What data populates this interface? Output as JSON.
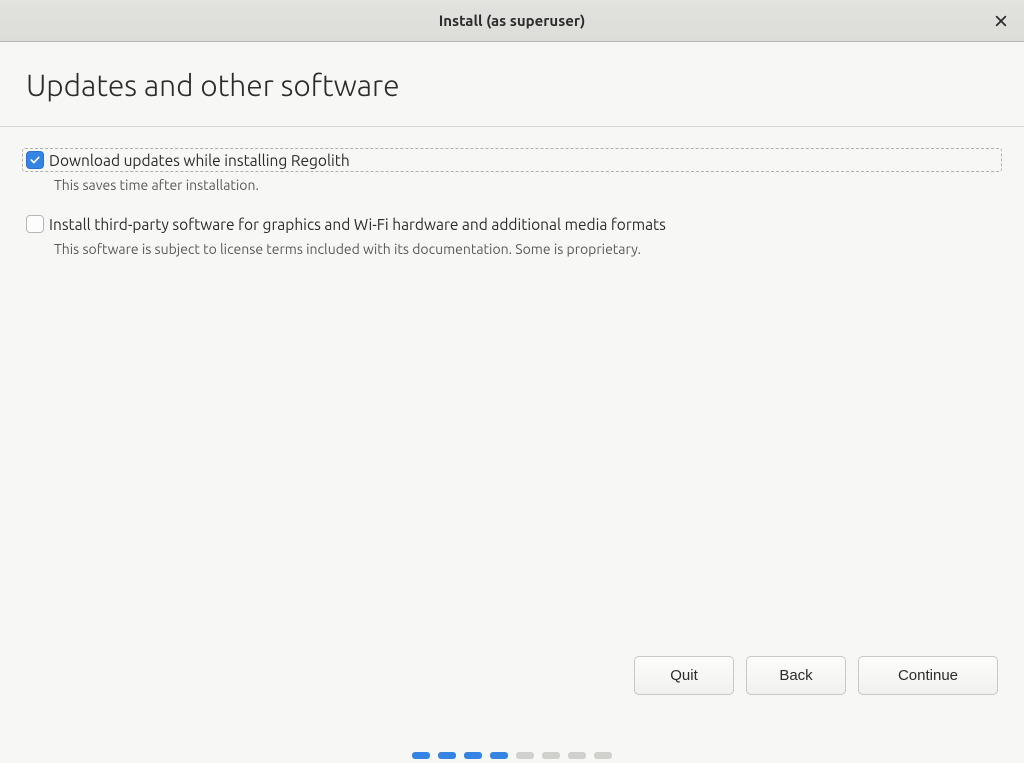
{
  "titlebar": {
    "title": "Install (as superuser)"
  },
  "page": {
    "heading": "Updates and other software"
  },
  "options": {
    "download_updates": {
      "label": "Download updates while installing Regolith",
      "description": "This saves time after installation.",
      "checked": true
    },
    "third_party": {
      "label": "Install third-party software for graphics and Wi-Fi hardware and additional media formats",
      "description": "This software is subject to license terms included with its documentation. Some is proprietary.",
      "checked": false
    }
  },
  "buttons": {
    "quit": "Quit",
    "back": "Back",
    "continue": "Continue"
  },
  "progress": {
    "total": 8,
    "active": [
      0,
      1,
      2,
      3
    ]
  }
}
